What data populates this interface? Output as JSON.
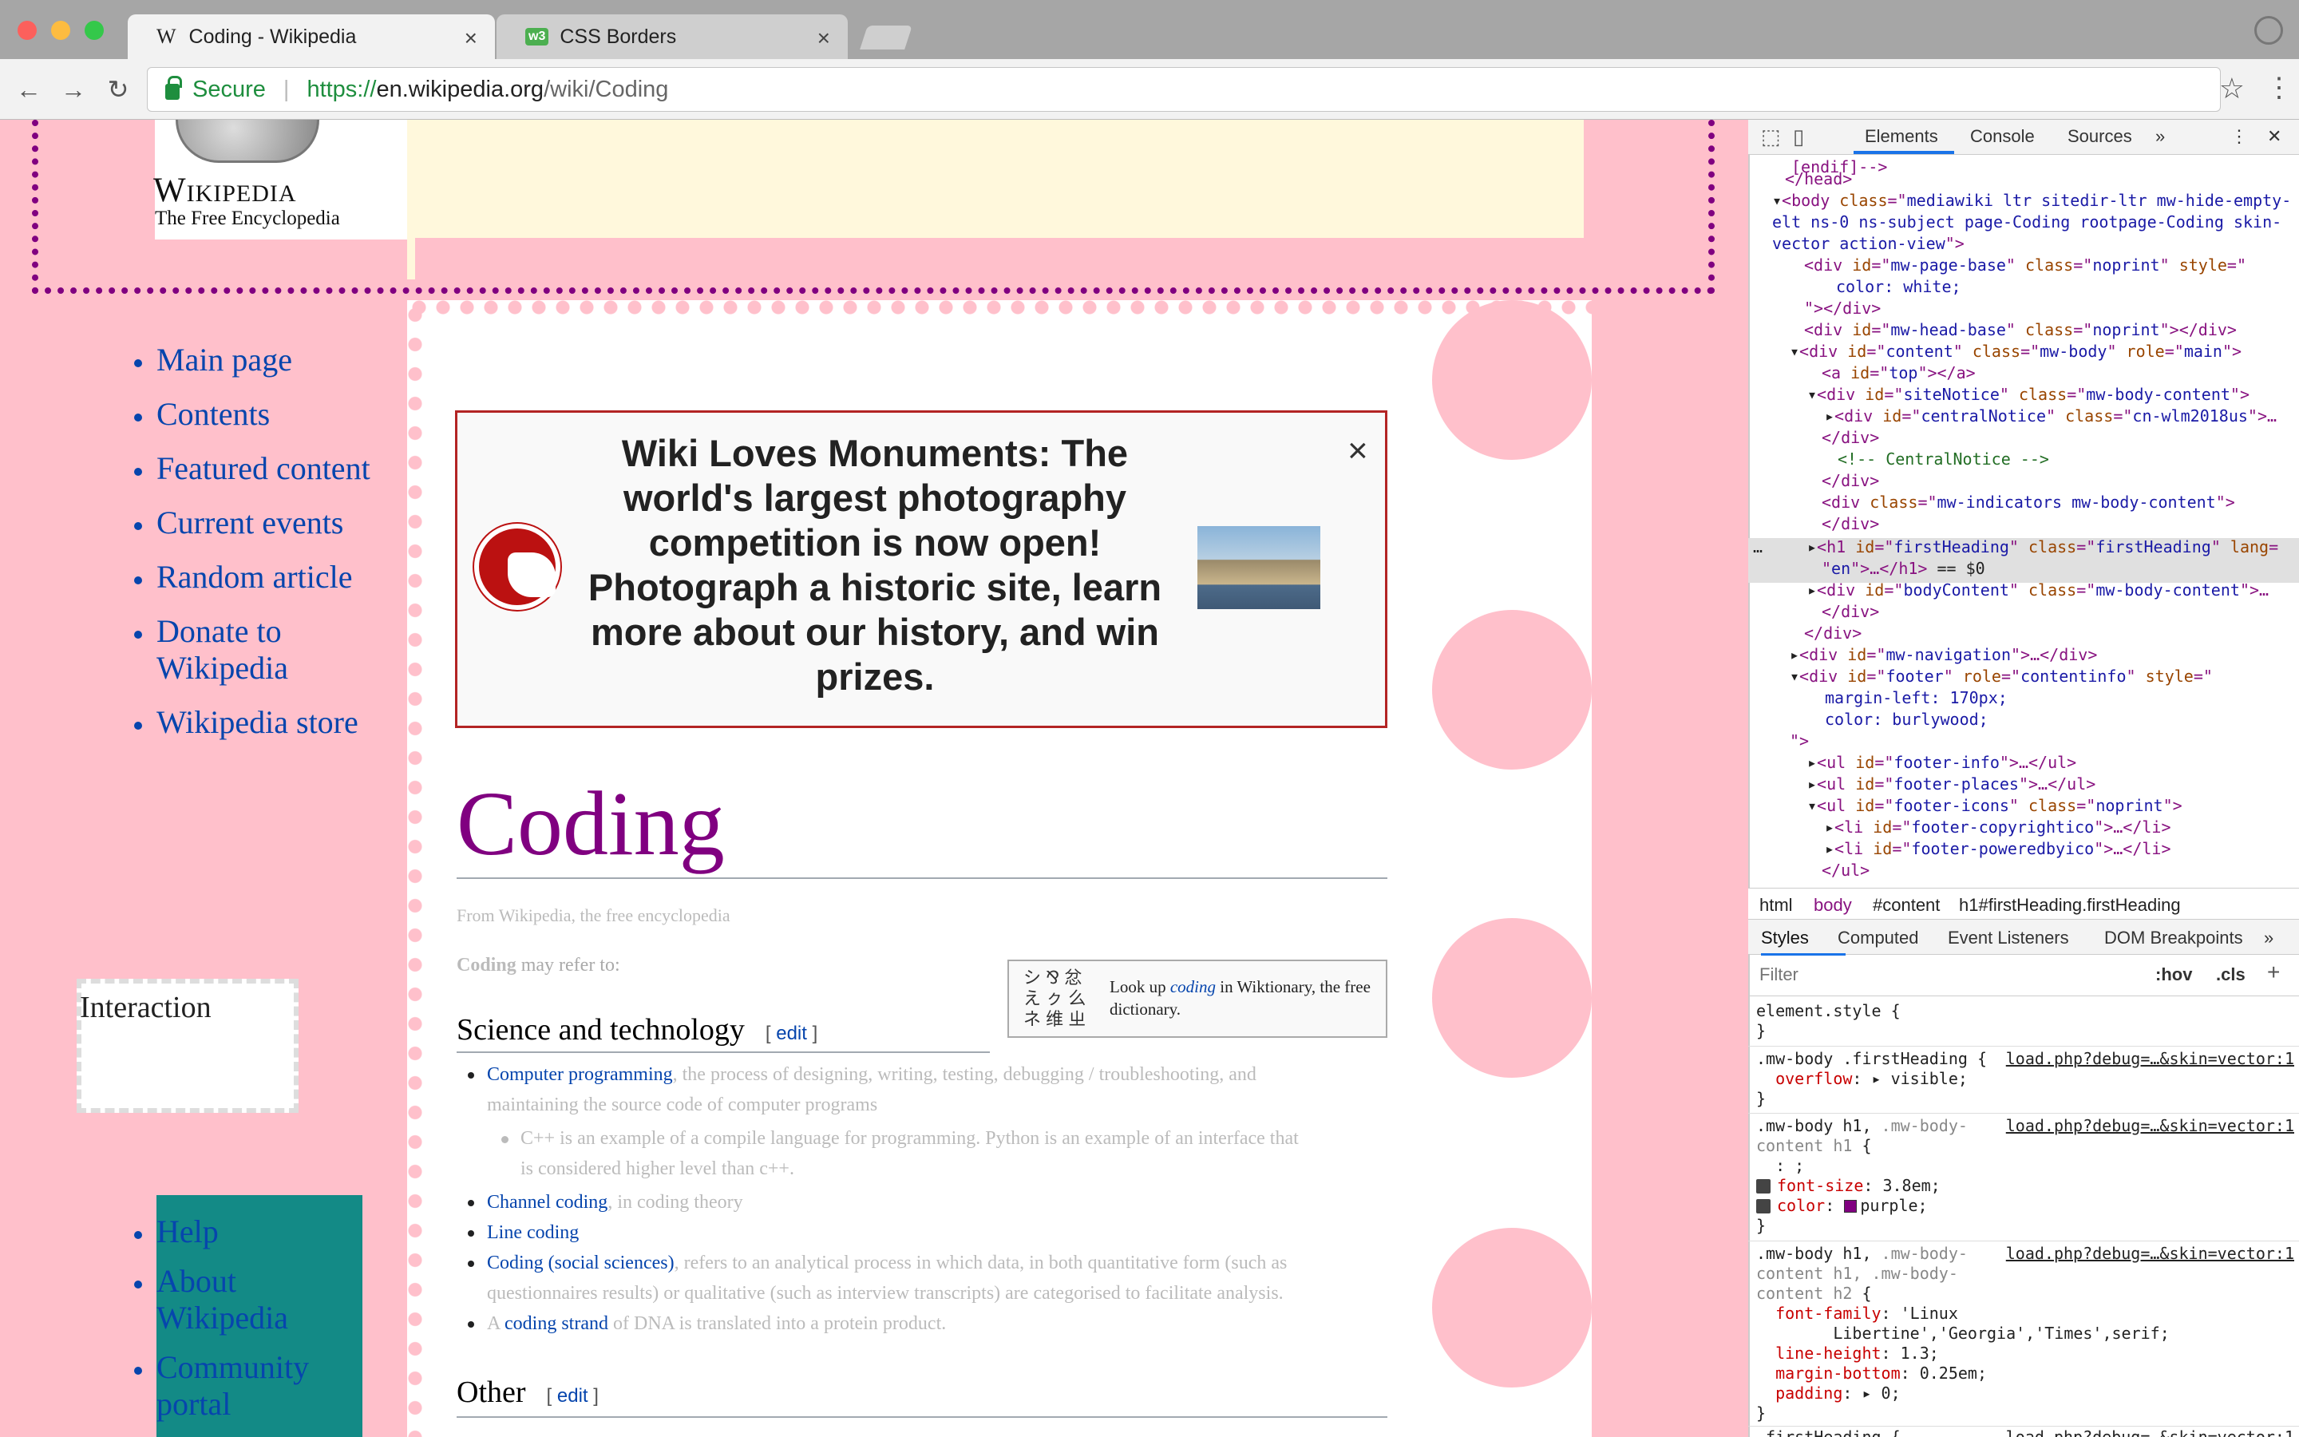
{
  "browser": {
    "tabs": [
      {
        "favicon": "W",
        "title": "Coding - Wikipedia"
      },
      {
        "favicon": "w3",
        "title": "CSS Borders"
      }
    ],
    "security_label": "Secure",
    "url_protocol": "https://",
    "url_host": "en.wikipedia.org",
    "url_path": "/wiki/Coding"
  },
  "wiki": {
    "logo_name": "Wikipedia",
    "logo_tagline": "The Free Encyclopedia",
    "nav_main": [
      "Main page",
      "Contents",
      "Featured content",
      "Current events",
      "Random article",
      "Donate to Wikipedia",
      "Wikipedia store"
    ],
    "interaction_title": "Interaction",
    "nav_tools": [
      "Help",
      "About Wikipedia",
      "Community portal"
    ],
    "notice_text": "Wiki Loves Monuments: The world's largest photography competition is now open! Photograph a historic site, learn more about our history, and win prizes.",
    "notice_close": "×",
    "heading": "Coding",
    "from": "From Wikipedia, the free encyclopedia",
    "lead_term": "Coding",
    "lead_rest": " may refer to:",
    "wiktionary": {
      "pre": "Look up ",
      "term": "coding",
      "post": " in Wiktionary, the free dictionary."
    },
    "section1": {
      "title": "Science and technology",
      "edit": "edit"
    },
    "items1": [
      {
        "link": "Computer programming",
        "rest": ", the process of designing, writing, testing, debugging / troubleshooting, and maintaining the source code of computer programs"
      },
      {
        "sub": true,
        "link": "",
        "rest": "C++ is an example of a compile language for programming. Python is an example of an interface that is considered higher level than c++."
      },
      {
        "link": "Channel coding",
        "rest": ", in coding theory"
      },
      {
        "link": "Line coding",
        "rest": ""
      },
      {
        "link": "Coding (social sciences)",
        "rest": ", refers to an analytical process in which data, in both quantitative form (such as questionnaires results) or qualitative (such as interview transcripts) are categorised to facilitate analysis."
      },
      {
        "pre": "A ",
        "link": "coding strand",
        "rest": " of DNA is translated into a protein product."
      }
    ],
    "section2": {
      "title": "Other",
      "edit": "edit"
    }
  },
  "devtools": {
    "tabs": [
      "Elements",
      "Console",
      "Sources"
    ],
    "breadcrumbs": [
      "html",
      "body",
      "#content",
      "h1#firstHeading.firstHeading"
    ],
    "subtabs": [
      "Styles",
      "Computed",
      "Event Listeners",
      "DOM Breakpoints"
    ],
    "filter_placeholder": "Filter",
    "hov": ":hov",
    "cls": ".cls",
    "source_link": "load.php?debug=…&skin=vector:1"
  },
  "colors": {
    "page_bg": "#ffc0cb",
    "heading": "#800080",
    "link": "#0645ad",
    "banner": "#fff8dc",
    "teal": "#138a86"
  },
  "icons": [
    "back-icon",
    "forward-icon",
    "reload-icon",
    "lock-icon",
    "star-icon",
    "menu-icon",
    "close-icon",
    "inspect-icon",
    "device-icon"
  ]
}
